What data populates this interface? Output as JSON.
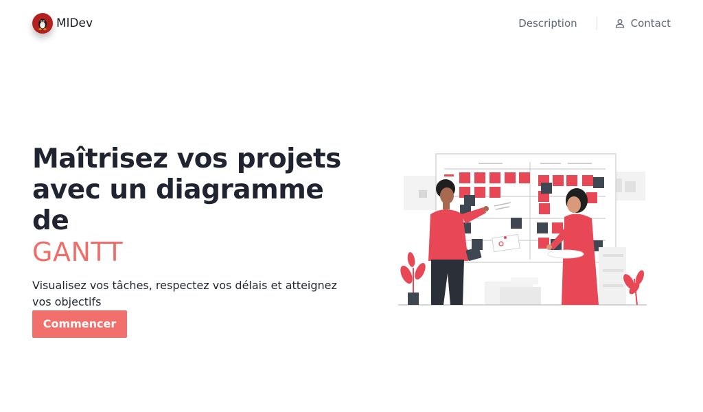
{
  "brand": {
    "name": "MlDev",
    "logo_icon": "linux-penguin-icon"
  },
  "nav": {
    "links": [
      {
        "label": "Description"
      },
      {
        "label": "Contact",
        "icon": "user-icon"
      }
    ]
  },
  "hero": {
    "title_line1": "Maîtrisez vos projets",
    "title_line2": "avec un diagramme de",
    "title_accent": "GANTT",
    "subtitle": "Visualisez vos tâches, respectez vos délais et atteignez vos objectifs",
    "cta_label": "Commencer"
  },
  "colors": {
    "accent": "#f2706b",
    "logo": "#b3211f",
    "text_dark": "#1f2430",
    "nav_text": "#5d6775"
  }
}
